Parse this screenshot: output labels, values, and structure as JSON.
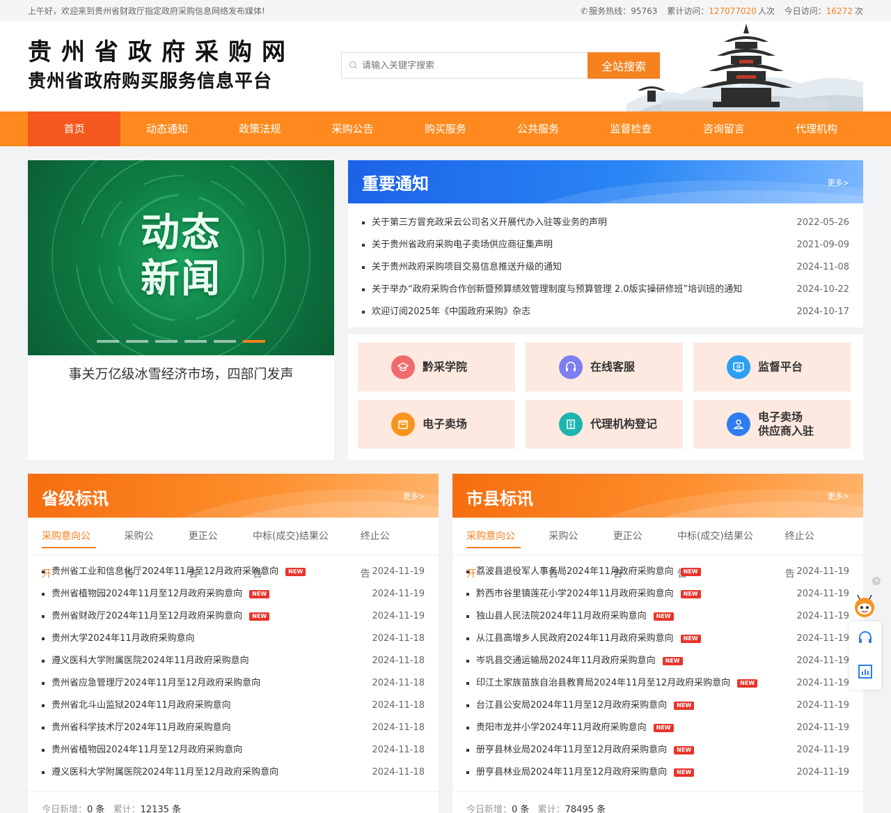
{
  "topbar": {
    "greeting": "上午好，欢迎来到贵州省财政厅指定政府采购信息网络发布媒体!",
    "hotline_label": "服务热线：",
    "hotline": "95763",
    "total_label": "累计访问：",
    "total": "127077020",
    "total_unit": "人次",
    "today_label": "今日访问：",
    "today": "16272",
    "today_unit": "次"
  },
  "header": {
    "logo_line1": "贵州省政府采购网",
    "logo_line2": "贵州省政府购买服务信息平台",
    "search_placeholder": "请输入关键字搜索",
    "search_button": "全站搜索"
  },
  "nav": [
    "首页",
    "动态通知",
    "政策法规",
    "采购公告",
    "购买服务",
    "公共服务",
    "监督检查",
    "咨询留言",
    "代理机构"
  ],
  "carousel": {
    "banner_line1": "动态",
    "banner_line2": "新闻",
    "caption": "事关万亿级冰雪经济市场，四部门发声"
  },
  "notice": {
    "title": "重要通知",
    "more": "更多>",
    "items": [
      {
        "text": "关于第三方冒充政采云公司名义开展代办入驻等业务的声明",
        "date": "2022-05-26"
      },
      {
        "text": "关于贵州省政府采购电子卖场供应商征集声明",
        "date": "2021-09-09"
      },
      {
        "text": "关于贵州政府采购项目交易信息推送升级的通知",
        "date": "2024-11-08"
      },
      {
        "text": "关于举办“政府采购合作创新暨预算绩效管理制度与预算管理 2.0版实操研修班”培训班的通知",
        "date": "2024-10-22"
      },
      {
        "text": "欢迎订阅2025年《中国政府采购》杂志",
        "date": "2024-10-17"
      }
    ]
  },
  "services": [
    {
      "label": "黔采学院",
      "color": "#f06b6b"
    },
    {
      "label": "在线客服",
      "color": "#7b7ff0"
    },
    {
      "label": "监督平台",
      "color": "#2b9ff0"
    },
    {
      "label": "电子卖场",
      "color": "#f7941d"
    },
    {
      "label": "代理机构登记",
      "color": "#1eb4b0"
    },
    {
      "label": "电子卖场供应商入驻",
      "label_l1": "电子卖场",
      "label_l2": "供应商入驻",
      "color": "#2f7cf0"
    }
  ],
  "tabs": [
    "采购意向公开",
    "采购公告",
    "更正公告",
    "中标(成交)结果公告",
    "终止公告"
  ],
  "new_badge": "NEW",
  "provincial": {
    "title": "省级标讯",
    "more": "更多>",
    "items": [
      {
        "text": "贵州省工业和信息化厅2024年11月至12月政府采购意向",
        "new": true,
        "date": "2024-11-19"
      },
      {
        "text": "贵州省植物园2024年11月至12月政府采购意向",
        "new": true,
        "date": "2024-11-19"
      },
      {
        "text": "贵州省财政厅2024年11月至12月政府采购意向",
        "new": true,
        "date": "2024-11-19"
      },
      {
        "text": "贵州大学2024年11月政府采购意向",
        "new": false,
        "date": "2024-11-18"
      },
      {
        "text": "遵义医科大学附属医院2024年11月政府采购意向",
        "new": false,
        "date": "2024-11-18"
      },
      {
        "text": "贵州省应急管理厅2024年11月至12月政府采购意向",
        "new": false,
        "date": "2024-11-18"
      },
      {
        "text": "贵州省北斗山监狱2024年11月政府采购意向",
        "new": false,
        "date": "2024-11-18"
      },
      {
        "text": "贵州省科学技术厅2024年11月政府采购意向",
        "new": false,
        "date": "2024-11-18"
      },
      {
        "text": "贵州省植物园2024年11月至12月政府采购意向",
        "new": false,
        "date": "2024-11-18"
      },
      {
        "text": "遵义医科大学附属医院2024年11月至12月政府采购意向",
        "new": false,
        "date": "2024-11-18"
      }
    ],
    "today_label": "今日新增：",
    "today": "0 条",
    "total_label": "累计：",
    "total": "12135 条"
  },
  "city": {
    "title": "市县标讯",
    "more": "更多>",
    "items": [
      {
        "text": "荔波县退役军人事务局2024年11月政府采购意向",
        "new": true,
        "date": "2024-11-19"
      },
      {
        "text": "黔西市谷里镇莲花小学2024年11月政府采购意向",
        "new": true,
        "date": "2024-11-19"
      },
      {
        "text": "独山县人民法院2024年11月政府采购意向",
        "new": true,
        "date": "2024-11-19"
      },
      {
        "text": "从江县高增乡人民政府2024年11月政府采购意向",
        "new": true,
        "date": "2024-11-19"
      },
      {
        "text": "岑巩县交通运输局2024年11月政府采购意向",
        "new": true,
        "date": "2024-11-19"
      },
      {
        "text": "印江土家族苗族自治县教育局2024年11月至12月政府采购意向",
        "new": true,
        "date": "2024-11-19"
      },
      {
        "text": "台江县公安局2024年11月至12月政府采购意向",
        "new": true,
        "date": "2024-11-19"
      },
      {
        "text": "贵阳市龙井小学2024年11月政府采购意向",
        "new": true,
        "date": "2024-11-19"
      },
      {
        "text": "册亨县林业局2024年11月至12月政府采购意向",
        "new": true,
        "date": "2024-11-19"
      },
      {
        "text": "册亨县林业局2024年11月至12月政府采购意向",
        "new": true,
        "date": "2024-11-19"
      }
    ],
    "today_label": "今日新增：",
    "today": "0 条",
    "total_label": "累计：",
    "total": "78495 条"
  },
  "float_close": "×",
  "colors": {
    "accent": "#f5801e",
    "nav": "#fe8a1f",
    "nav_active": "#f5581e",
    "blue": "#1c62e8",
    "new": "#e8342a"
  }
}
